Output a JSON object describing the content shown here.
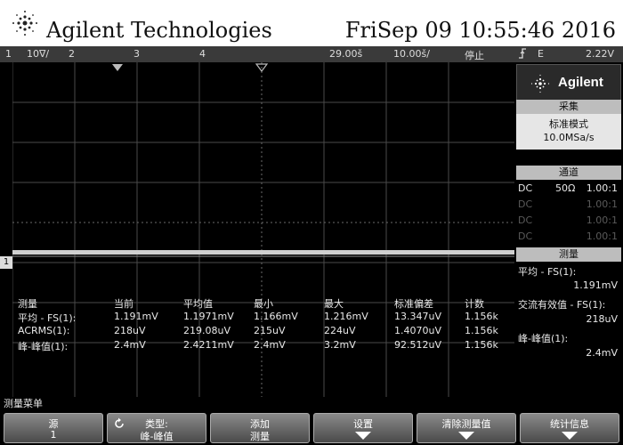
{
  "header": {
    "brand": "Agilent Technologies",
    "datetime": "FriSep 09 10:55:46 2016"
  },
  "status_bar": {
    "ch1_num": "1",
    "ch1_scale": "10∇/",
    "ch2_num": "2",
    "ch3_num": "3",
    "ch4_num": "4",
    "delay": "29.00š",
    "timebase": "10.00š/",
    "run_state": "停止",
    "trigger_icon": "trigger-edge-icon",
    "trigger_source": "E",
    "trigger_level": "2.22V"
  },
  "right_panel": {
    "brand": "Agilent",
    "acquisition": {
      "title": "采集",
      "mode": "标准模式",
      "rate": "10.0MSa/s"
    },
    "channels": {
      "title": "通道",
      "rows": [
        {
          "coupling": "DC",
          "impedance": "50Ω",
          "probe": "1.00:1"
        },
        {
          "coupling": "DC",
          "impedance": "",
          "probe": "1.00:1"
        },
        {
          "coupling": "DC",
          "impedance": "",
          "probe": "1.00:1"
        },
        {
          "coupling": "DC",
          "impedance": "",
          "probe": "1.00:1"
        }
      ]
    },
    "measure": {
      "title": "测量",
      "items": [
        {
          "label": "平均 - FS(1):",
          "value": "1.191mV"
        },
        {
          "label": "交流有效值 - FS(1):",
          "value": "218uV"
        },
        {
          "label": "峰-峰值(1):",
          "value": "2.4mV"
        }
      ]
    }
  },
  "measurement_table": {
    "headers": [
      "测量",
      "当前",
      "平均值",
      "最小",
      "最大",
      "标准偏差",
      "计数"
    ],
    "rows": [
      [
        "平均 - FS(1):",
        "1.191mV",
        "1.1971mV",
        "1.166mV",
        "1.216mV",
        "13.347uV",
        "1.156k"
      ],
      [
        "ACRMS(1):",
        "218uV",
        "219.08uV",
        "215uV",
        "224uV",
        "1.4070uV",
        "1.156k"
      ],
      [
        "峰-峰值(1):",
        "2.4mV",
        "2.4211mV",
        "2.4mV",
        "3.2mV",
        "92.512uV",
        "1.156k"
      ]
    ]
  },
  "channel_marker": "1",
  "menu_title": "测量菜单",
  "softkeys": [
    {
      "line1": "源",
      "line2": "1",
      "icon": ""
    },
    {
      "line1": "类型:",
      "line2": "峰-峰值",
      "icon": "rotate-knob-icon"
    },
    {
      "line1": "添加",
      "line2": "测量",
      "icon": ""
    },
    {
      "line1": "设置",
      "line2": "",
      "icon": "down-arrow-icon"
    },
    {
      "line1": "清除测量值",
      "line2": "",
      "icon": "down-arrow-icon"
    },
    {
      "line1": "统计信息",
      "line2": "",
      "icon": "down-arrow-icon"
    }
  ],
  "colors": {
    "screen_bg": "#000000",
    "trace": "#cfcfcf",
    "panel_head": "#bdbdbd",
    "panel_body": "#e6e6e6"
  }
}
